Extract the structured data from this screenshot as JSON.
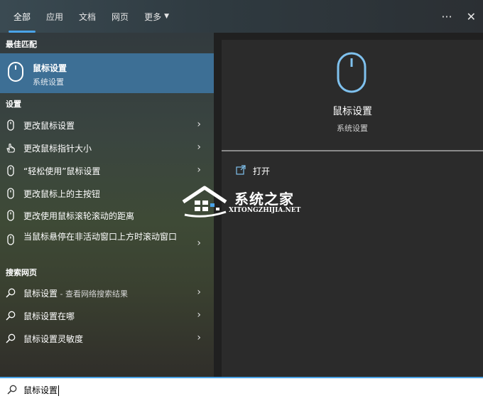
{
  "tabs": [
    {
      "label": "全部",
      "active": true
    },
    {
      "label": "应用"
    },
    {
      "label": "文档"
    },
    {
      "label": "网页"
    },
    {
      "label": "更多"
    }
  ],
  "top_actions": {
    "more_glyph": "···",
    "close_glyph": "✕"
  },
  "best_match": {
    "section": "最佳匹配",
    "title": "鼠标设置",
    "subtitle": "系统设置",
    "icon": "mouse-icon"
  },
  "settings": {
    "section": "设置",
    "items": [
      {
        "label": "更改鼠标设置",
        "icon": "mouse-icon"
      },
      {
        "label": "更改鼠标指针大小",
        "icon": "pointer-hand-icon"
      },
      {
        "label": "“轻松使用”鼠标设置",
        "icon": "mouse-icon"
      },
      {
        "label": "更改鼠标上的主按钮",
        "icon": "mouse-icon"
      },
      {
        "label": "更改使用鼠标滚轮滚动的距离",
        "icon": "mouse-icon"
      },
      {
        "label": "当鼠标悬停在非活动窗口上方时滚动窗口",
        "icon": "mouse-icon"
      }
    ]
  },
  "web": {
    "section": "搜索网页",
    "items": [
      {
        "label": "鼠标设置",
        "suffix": " - 查看网络搜索结果"
      },
      {
        "label": "鼠标设置在哪",
        "suffix": ""
      },
      {
        "label": "鼠标设置灵敏度",
        "suffix": ""
      }
    ]
  },
  "preview": {
    "title": "鼠标设置",
    "subtitle": "系统设置",
    "action_open": "打开"
  },
  "watermark": {
    "name": "系统之家",
    "url": "XITONGZHIJIA.NET"
  },
  "search": {
    "value": "鼠标设置"
  },
  "colors": {
    "accent": "#4aa3e8",
    "selected": "#3d6f95",
    "preview_bg": "#2b2b2b"
  }
}
